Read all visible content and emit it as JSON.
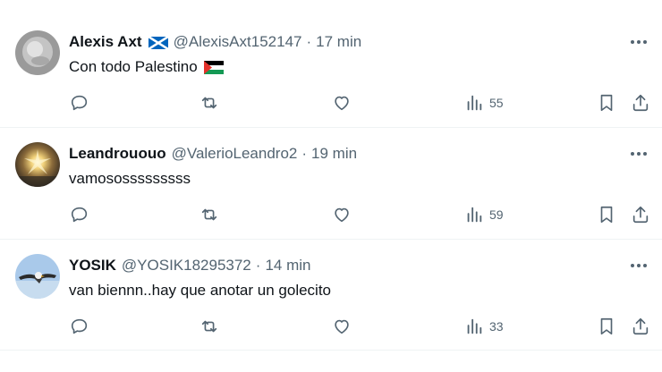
{
  "tweets": [
    {
      "name": "Alexis Axt",
      "handle": "@AlexisAxt152147",
      "separator": "·",
      "time": "17 min",
      "text": "Con todo Palestino",
      "views": "55",
      "name_flag_icon": "scotland-flag-icon",
      "text_flag_icon": "palestine-flag-icon"
    },
    {
      "name": "Leandrououo",
      "handle": "@ValerioLeandro2",
      "separator": "·",
      "time": "19 min",
      "text": "vamososssssssss",
      "views": "59"
    },
    {
      "name": "YOSIK",
      "handle": "@YOSIK18295372",
      "separator": "·",
      "time": "14 min",
      "text": "van biennn..hay que anotar un golecito",
      "views": "33"
    }
  ],
  "colors": {
    "text_primary": "#0f1419",
    "text_secondary": "#536471",
    "divider": "#eff3f4"
  },
  "icons": [
    "reply-icon",
    "retweet-icon",
    "like-icon",
    "views-icon",
    "bookmark-icon",
    "share-icon",
    "more-icon"
  ]
}
